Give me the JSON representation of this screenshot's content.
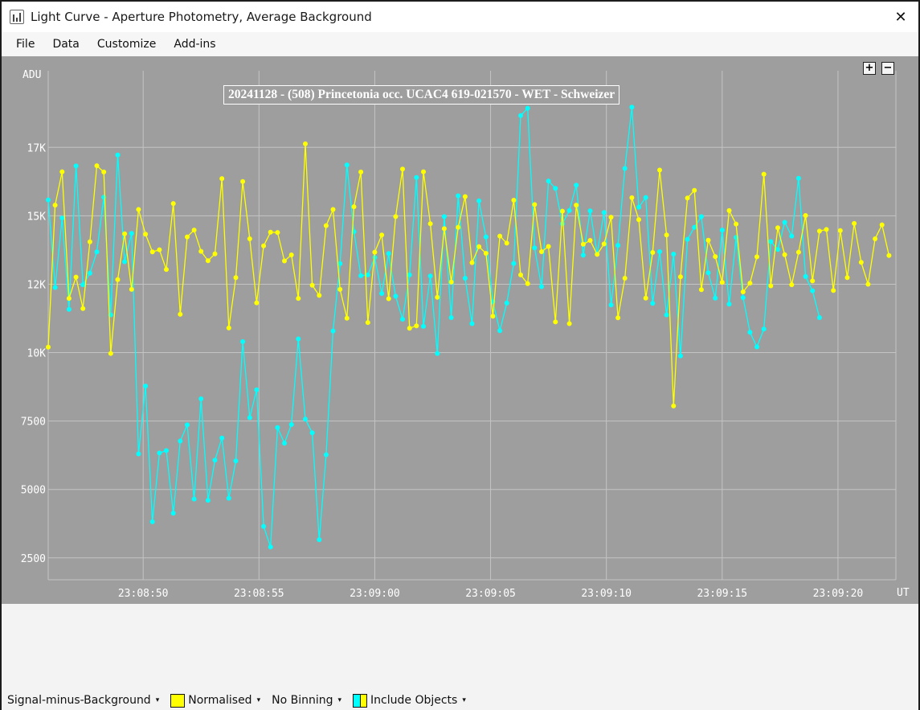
{
  "window": {
    "title": "Light Curve - Aperture Photometry, Average Background",
    "close_glyph": "✕"
  },
  "menu": [
    "File",
    "Data",
    "Customize",
    "Add-ins"
  ],
  "zoom": {
    "in": "+",
    "out": "−"
  },
  "status": {
    "signal": "Signal-minus-Background",
    "normalise": "Normalised",
    "binning": "No Binning",
    "include": "Include Objects",
    "caret": "▾"
  },
  "colors": {
    "plot_bg": "#9e9e9e",
    "grid": "#c4c4c4",
    "series_target": "#00ffff",
    "series_comparison": "#ffff00"
  },
  "chart_data": {
    "type": "line",
    "title": "20241128 - (508) Princetonia occ. UCAC4 619-021570 - WET - Schweizer",
    "ylabel": "ADU",
    "xlabel": "UT",
    "ylim": [
      1700,
      20300
    ],
    "xlim": [
      "23:08:45.9",
      "23:09:22.5"
    ],
    "grid": true,
    "x_ticks": [
      "23:08:50",
      "23:08:55",
      "23:09:00",
      "23:09:05",
      "23:09:10",
      "23:09:15",
      "23:09:20"
    ],
    "y_ticks": [
      {
        "value": 2500,
        "label": "2500"
      },
      {
        "value": 5000,
        "label": "5000"
      },
      {
        "value": 7500,
        "label": "7500"
      },
      {
        "value": 10000,
        "label": "10K"
      },
      {
        "value": 12500,
        "label": "12K"
      },
      {
        "value": 15000,
        "label": "15K"
      },
      {
        "value": 17500,
        "label": "17K"
      }
    ],
    "x_start": "23:08:45.9",
    "x_step_seconds": 0.3,
    "series": [
      {
        "color": "#00ffff",
        "values": [
          15580,
          12380,
          14920,
          11580,
          16820,
          12480,
          12900,
          13680,
          15680,
          11380,
          17220,
          13320,
          14360,
          6300,
          8780,
          3820,
          6330,
          6420,
          4130,
          6770,
          7360,
          4650,
          8310,
          4600,
          6070,
          6880,
          4680,
          6040,
          10400,
          7620,
          8640,
          3650,
          2900,
          7260,
          6690,
          7370,
          10500,
          7570,
          7070,
          3160,
          6270,
          10790,
          13250,
          16860,
          14420,
          12810,
          12840,
          13480,
          12160,
          13620,
          12060,
          11220,
          12840,
          16400,
          10960,
          12800,
          9970,
          14970,
          11280,
          15730,
          12720,
          11060,
          15550,
          14230,
          11860,
          10800,
          11810,
          13260,
          18660,
          18930,
          13830,
          12410,
          16270,
          16000,
          14710,
          15190,
          16120,
          13560,
          15180,
          13620,
          15120,
          11740,
          13920,
          16730,
          18970,
          15310,
          15670,
          11800,
          13690,
          11380,
          13600,
          9880,
          14140,
          14580,
          14970,
          12920,
          11990,
          14480,
          11770,
          14210,
          12010,
          10740,
          10210,
          10860,
          14060,
          13770,
          14760,
          14260,
          16370,
          12780,
          12260,
          11280
        ]
      },
      {
        "color": "#ffff00",
        "values": [
          10200,
          15390,
          16610,
          11980,
          12760,
          11610,
          14050,
          16830,
          16600,
          9970,
          12670,
          14340,
          12310,
          15230,
          14330,
          13680,
          13760,
          13040,
          15450,
          11400,
          14230,
          14480,
          13700,
          13360,
          13610,
          16360,
          10900,
          12740,
          16250,
          14160,
          11820,
          13900,
          14400,
          14390,
          13350,
          13570,
          11980,
          17630,
          12460,
          12090,
          14640,
          15230,
          12310,
          11260,
          15330,
          16600,
          11100,
          13670,
          14300,
          11970,
          14970,
          16710,
          10890,
          10980,
          16610,
          14710,
          12020,
          14530,
          12580,
          14580,
          15700,
          13290,
          13870,
          13630,
          11330,
          14260,
          14000,
          15570,
          12840,
          12520,
          15410,
          13690,
          13880,
          11120,
          15170,
          11060,
          15390,
          13960,
          14100,
          13590,
          13970,
          14950,
          11270,
          12720,
          15660,
          14860,
          11990,
          13660,
          16670,
          14300,
          8050,
          12770,
          15650,
          15930,
          12300,
          14110,
          13510,
          12570,
          15190,
          14700,
          12220,
          12540,
          13500,
          16520,
          12440,
          14560,
          13580,
          12480,
          13670,
          15010,
          12620,
          14440,
          14500,
          12270,
          14460,
          12740,
          14720,
          13300,
          12500,
          14160,
          14670,
          13550
        ]
      }
    ]
  }
}
